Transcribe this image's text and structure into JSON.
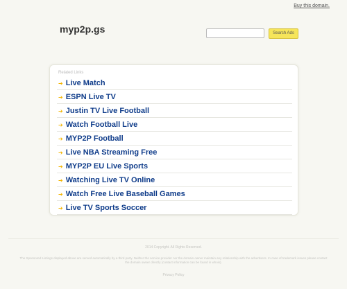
{
  "top": {
    "buy_domain": "Buy this domain."
  },
  "header": {
    "site_name": "myp2p.gs"
  },
  "search": {
    "placeholder": "",
    "button_label": "Search Ads"
  },
  "panel": {
    "related_label": "Related Links",
    "links": [
      "Live Match",
      "ESPN Live TV",
      "Justin TV Live Football",
      "Watch Football Live",
      "MYP2P Football",
      "Live NBA Streaming Free",
      "MYP2P EU Live Sports",
      "Watching Live TV Online",
      "Watch Free Live Baseball Games",
      "Live TV Sports Soccer"
    ]
  },
  "footer": {
    "copyright": "2014 Copyright. All Rights Reserved.",
    "disclaimer": "The Sponsored Listings displayed above are served automatically by a third party. Neither the service provider nor the domain owner maintain any relationship with the advertisers. In case of trademark issues please contact the domain owner directly (contact information can be found in whois).",
    "privacy": "Privacy Policy"
  },
  "colors": {
    "link": "#0f3c8a",
    "arrow": "#f3b400",
    "button": "#f6e55a"
  }
}
